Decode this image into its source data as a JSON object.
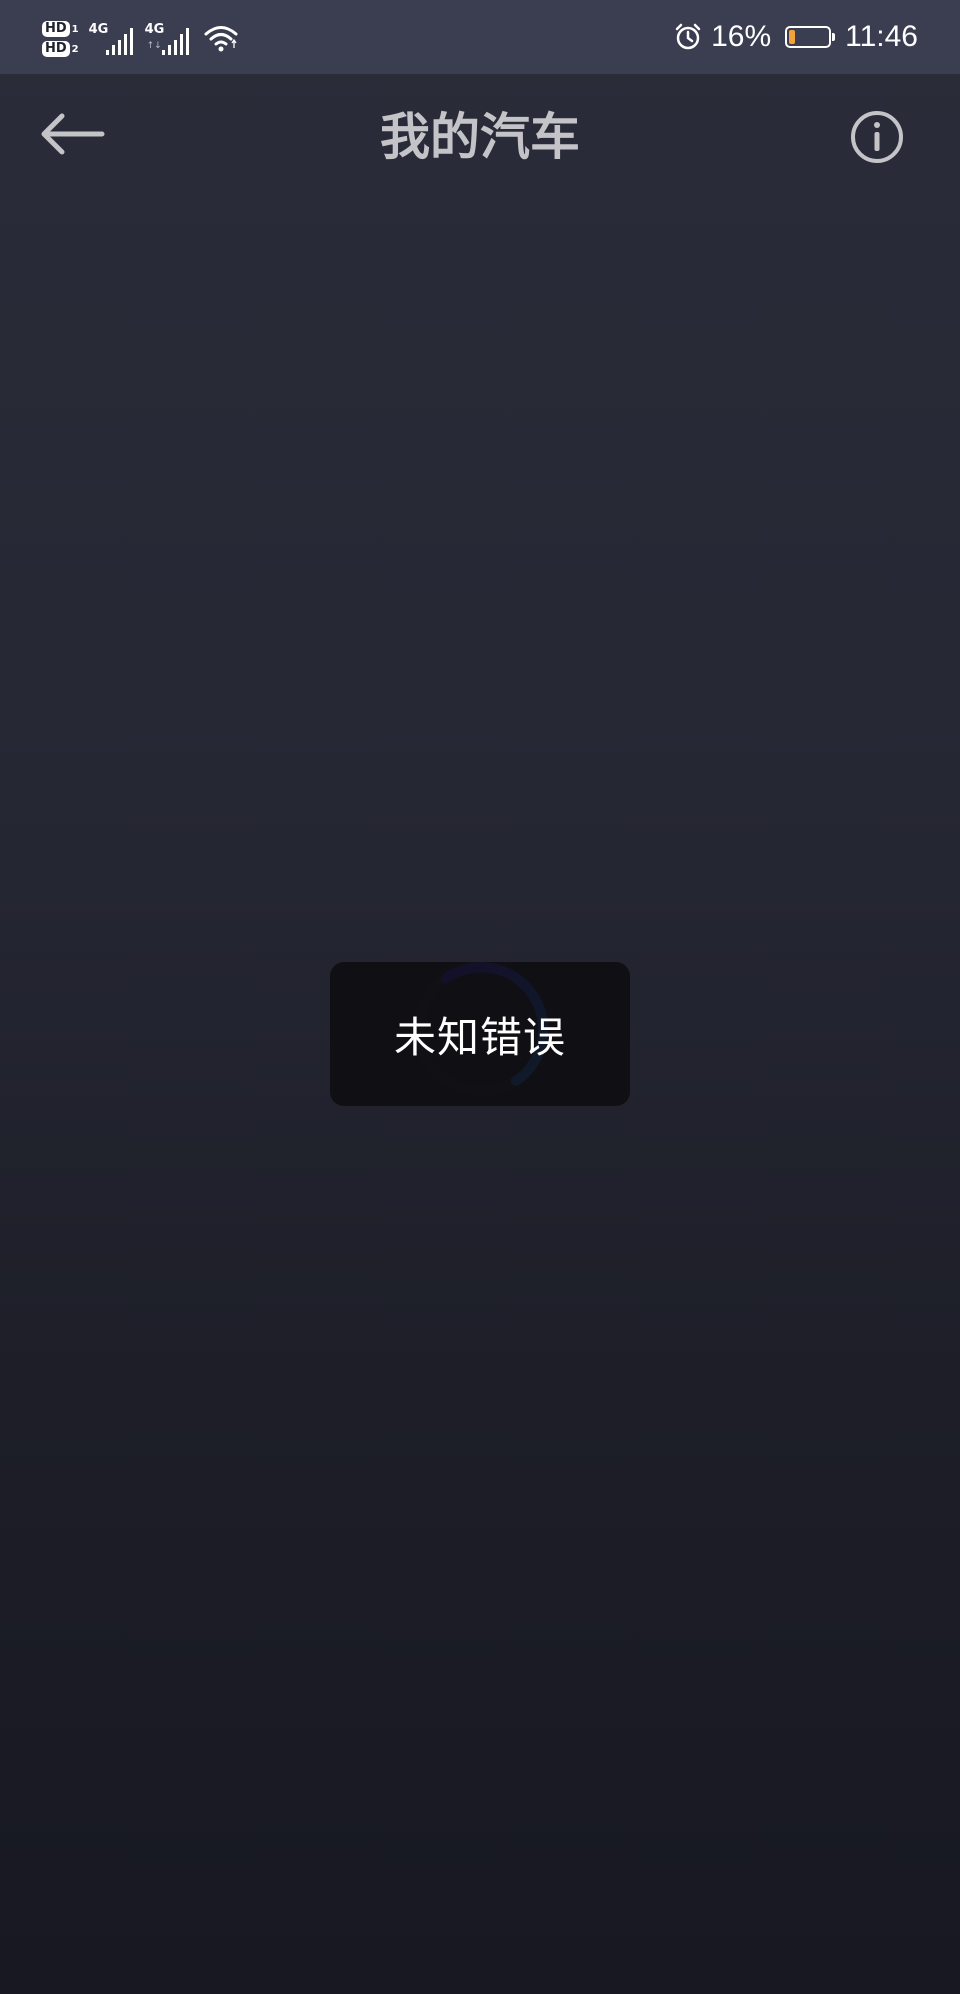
{
  "status_bar": {
    "hd1": "HD",
    "hd1_index": "1",
    "hd2": "HD",
    "hd2_index": "2",
    "network1": "4G",
    "network2": "4G",
    "network2_activity": "↑↓",
    "battery_text": "16%",
    "battery_level": 0.16,
    "battery_color": "#f4a23a",
    "time": "11:46"
  },
  "header": {
    "title": "我的汽车",
    "back_icon": "arrow-left-icon",
    "info_icon": "info-circle-icon"
  },
  "toast": {
    "message": "未知错误"
  },
  "loading": {
    "icon": "loading-spinner-icon"
  },
  "colors": {
    "background_top": "#2a2d39",
    "background_bottom": "#171821",
    "status_bar": "#3b3e50",
    "title": "#c3c3c8",
    "spinner_start": "#3a1fa8",
    "spinner_end": "#1f5fa6"
  }
}
